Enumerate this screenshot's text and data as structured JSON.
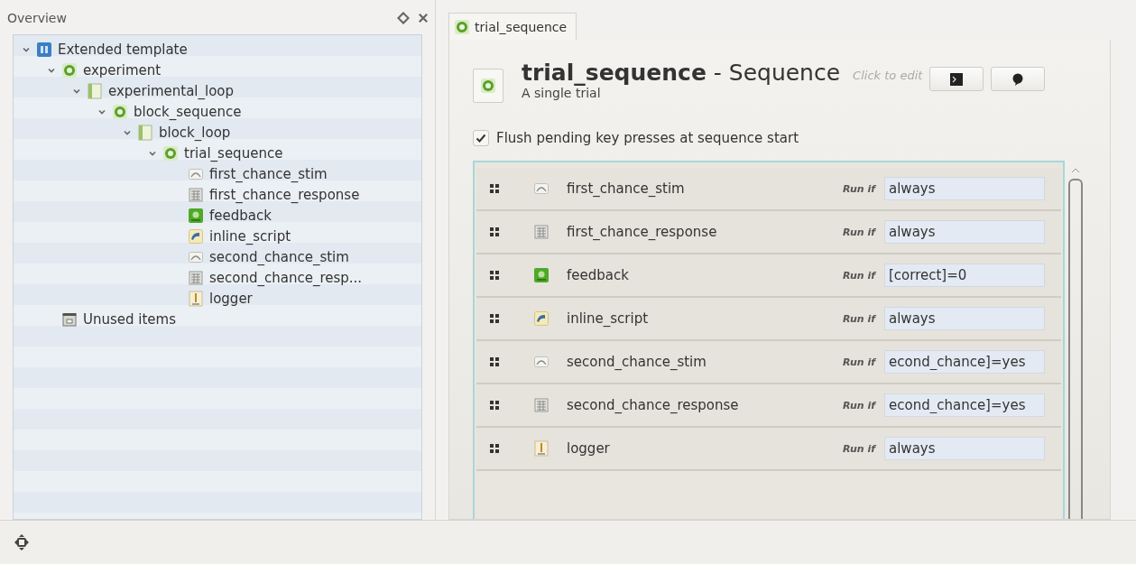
{
  "overview": {
    "title": "Overview",
    "tree": [
      {
        "label": "Extended template",
        "kind": "template",
        "expanded": true,
        "children": [
          {
            "label": "experiment",
            "kind": "sequence",
            "expanded": true,
            "children": [
              {
                "label": "experimental_loop",
                "kind": "loop",
                "expanded": true,
                "children": [
                  {
                    "label": "block_sequence",
                    "kind": "sequence",
                    "expanded": true,
                    "children": [
                      {
                        "label": "block_loop",
                        "kind": "loop",
                        "expanded": true,
                        "children": [
                          {
                            "label": "trial_sequence",
                            "kind": "sequence",
                            "expanded": true,
                            "children": [
                              {
                                "label": "first_chance_stim",
                                "kind": "sketchpad"
                              },
                              {
                                "label": "first_chance_response",
                                "kind": "keyboard"
                              },
                              {
                                "label": "feedback",
                                "kind": "feedback"
                              },
                              {
                                "label": "inline_script",
                                "kind": "inline"
                              },
                              {
                                "label": "second_chance_stim",
                                "kind": "sketchpad"
                              },
                              {
                                "label": "second_chance_resp...",
                                "kind": "keyboard"
                              },
                              {
                                "label": "logger",
                                "kind": "logger"
                              }
                            ]
                          }
                        ]
                      }
                    ]
                  }
                ]
              }
            ]
          },
          {
            "label": "Unused items",
            "kind": "unused"
          }
        ]
      }
    ]
  },
  "tabs": [
    {
      "label": "trial_sequence",
      "kind": "sequence",
      "selected": true
    }
  ],
  "editor": {
    "title": "**trial_sequence** - Sequence",
    "hint": "Click to edit",
    "description": "A single trial",
    "flush": {
      "label": "Flush pending key presses at sequence start",
      "checked": true
    },
    "rows": [
      {
        "name": "first_chance_stim",
        "kind": "sketchpad",
        "run_if_label": "Run if",
        "run_if": "always"
      },
      {
        "name": "first_chance_response",
        "kind": "keyboard",
        "run_if_label": "Run if",
        "run_if": "always"
      },
      {
        "name": "feedback",
        "kind": "feedback",
        "run_if_label": "Run if",
        "run_if": "[correct]=0"
      },
      {
        "name": "inline_script",
        "kind": "inline",
        "run_if_label": "Run if",
        "run_if": "always"
      },
      {
        "name": "second_chance_stim",
        "kind": "sketchpad",
        "run_if_label": "Run if",
        "run_if": "econd_chance]=yes"
      },
      {
        "name": "second_chance_response",
        "kind": "keyboard",
        "run_if_label": "Run if",
        "run_if": "econd_chance]=yes"
      },
      {
        "name": "logger",
        "kind": "logger",
        "run_if_label": "Run if",
        "run_if": "always"
      }
    ]
  }
}
